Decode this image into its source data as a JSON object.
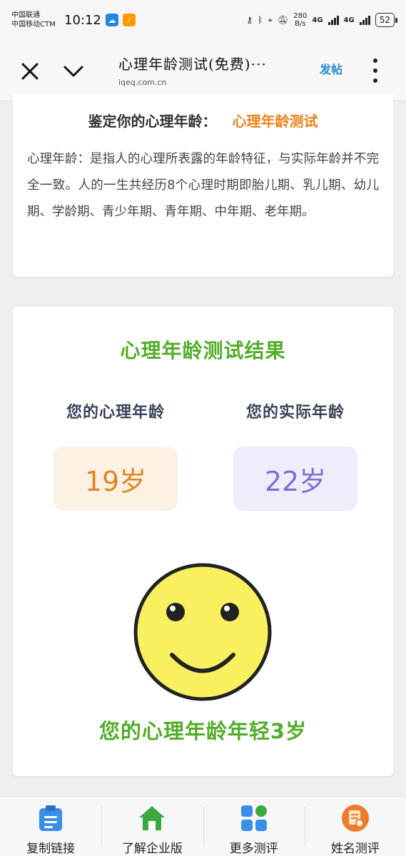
{
  "status_bar": {
    "carrier_1": "中国联通",
    "carrier_2": "中国移动CTM",
    "time": "10:12",
    "net_speed_value": "280",
    "net_speed_unit": "B/s",
    "network_1": "4G",
    "network_2": "4G",
    "battery": "52"
  },
  "header": {
    "title": "心理年龄测试(免费)···",
    "url": "iqeq.com.cn",
    "post_label": "发帖"
  },
  "intro": {
    "heading": "鉴定你的心理年龄：",
    "heading_accent": "心理年龄测试",
    "description": "心理年龄：是指人的心理所表露的年龄特征，与实际年龄并不完全一致。人的一生共经历8个心理时期即胎儿期、乳儿期、幼儿期、学龄期、青少年期、青年期、中年期、老年期。"
  },
  "result": {
    "title": "心理年龄测试结果",
    "psych_label": "您的心理年龄",
    "psych_value": "19岁",
    "real_label": "您的实际年龄",
    "real_value": "22岁",
    "summary": "您的心理年龄年轻3岁"
  },
  "bottom_nav": {
    "items": [
      {
        "label": "复制链接",
        "icon": "clipboard-icon"
      },
      {
        "label": "了解企业版",
        "icon": "home-icon"
      },
      {
        "label": "更多测评",
        "icon": "grid-icon"
      },
      {
        "label": "姓名测评",
        "icon": "document-badge-icon"
      }
    ]
  },
  "colors": {
    "accent_orange": "#e8831d",
    "result_green": "#53ad2a",
    "real_age_purple": "#7f6fd3",
    "link_blue": "#2a8ad2"
  }
}
